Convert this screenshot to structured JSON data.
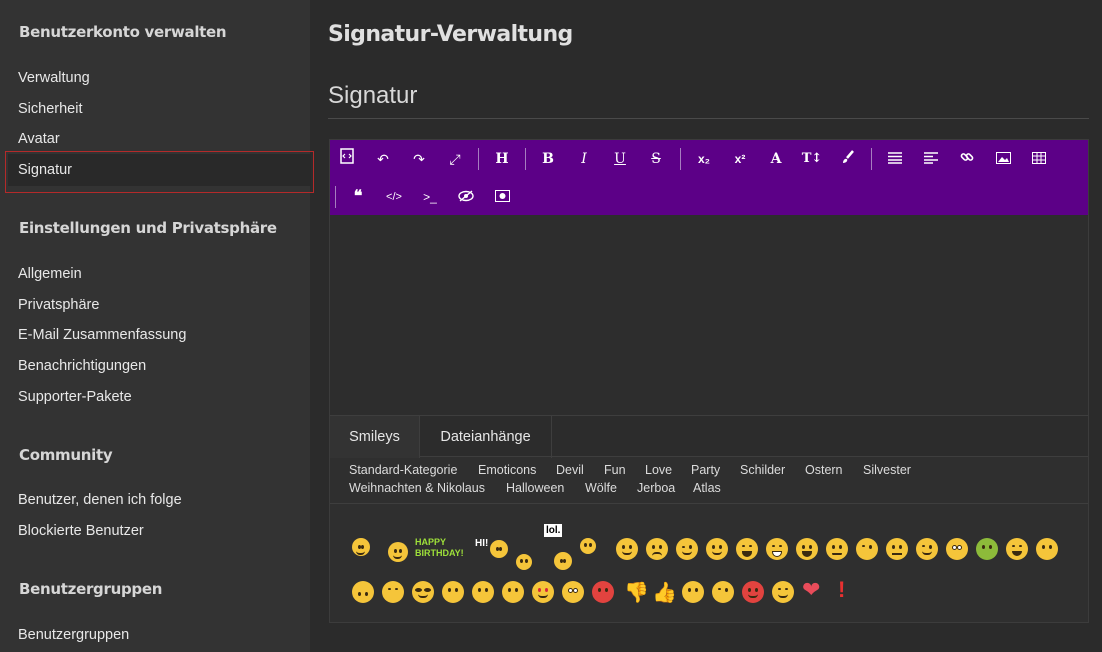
{
  "sidebar": {
    "sections": [
      {
        "heading": "Benutzerkonto verwalten",
        "items": [
          "Verwaltung",
          "Sicherheit",
          "Avatar",
          "Signatur"
        ]
      },
      {
        "heading": "Einstellungen und Privatsphäre",
        "items": [
          "Allgemein",
          "Privatsphäre",
          "E-Mail Zusammenfassung",
          "Benachrichtigungen",
          "Supporter-Pakete"
        ]
      },
      {
        "heading": "Community",
        "items": [
          "Benutzer, denen ich folge",
          "Blockierte Benutzer"
        ]
      },
      {
        "heading": "Benutzergruppen",
        "items": [
          "Benutzergruppen"
        ]
      }
    ],
    "active_item": "Signatur"
  },
  "main": {
    "page_title": "Signatur-Verwaltung",
    "section_title": "Signatur"
  },
  "toolbar": {
    "color": "#5c0087",
    "buttons_row1": [
      "source-code-icon",
      "undo-icon",
      "redo-icon",
      "fullscreen-icon",
      "heading-icon",
      "bold-icon",
      "italic-icon",
      "underline-icon",
      "strikethrough-icon",
      "subscript-icon",
      "superscript-icon",
      "font-color-icon",
      "font-size-icon",
      "format-brush-icon",
      "list-icon",
      "align-icon",
      "link-icon",
      "image-icon",
      "table-icon"
    ],
    "buttons_row2": [
      "quote-icon",
      "code-icon",
      "inline-code-icon",
      "spoiler-icon",
      "media-icon"
    ],
    "labels": {
      "heading": "H",
      "bold": "B",
      "italic": "I",
      "underline": "U",
      "strike": "S",
      "sub": "x₂",
      "sup": "x²",
      "fontcolor": "A",
      "fontsize": "T↕"
    }
  },
  "tabs": [
    "Smileys",
    "Dateianhänge"
  ],
  "active_tab": "Smileys",
  "categories_row1": [
    "Standard-Kategorie",
    "Emoticons",
    "Devil",
    "Fun",
    "Love",
    "Party",
    "Schilder",
    "Ostern",
    "Silvester"
  ],
  "categories_row2": [
    "Weihnachten & Nikolaus",
    "Halloween",
    "Wölfe",
    "Jerboa",
    "Atlas"
  ],
  "smileys_anim": {
    "birthday": "HAPPY BIRTHDAY!",
    "hi": "HI!",
    "lol": "lol."
  }
}
